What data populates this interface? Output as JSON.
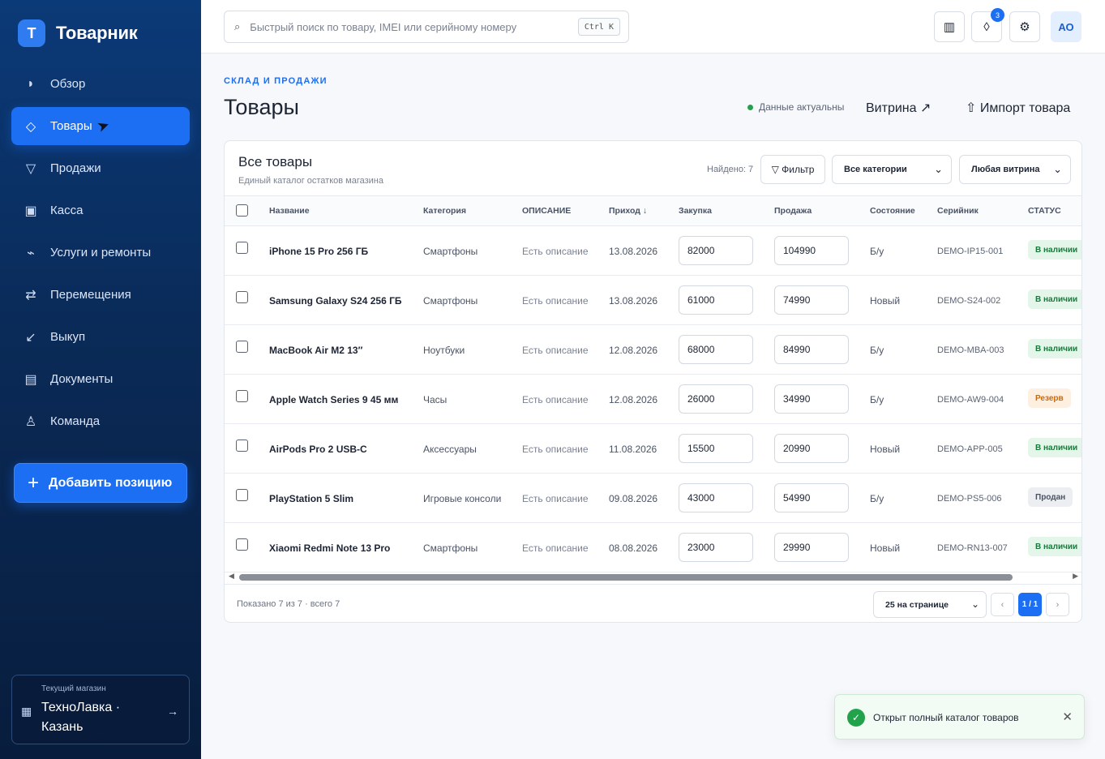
{
  "brand": {
    "logo_letter": "T",
    "name": "Товарник"
  },
  "sidebar": {
    "items": [
      {
        "label": "Обзор",
        "icon": "dot-icon",
        "glyph": "◗"
      },
      {
        "label": "Товары",
        "icon": "diamond-icon",
        "glyph": "◇"
      },
      {
        "label": "Продажи",
        "icon": "funnel-icon",
        "glyph": "▽"
      },
      {
        "label": "Касса",
        "icon": "register-icon",
        "glyph": "▣"
      },
      {
        "label": "Услуги и ремонты",
        "icon": "wrench-icon",
        "glyph": "⌁"
      },
      {
        "label": "Перемещения",
        "icon": "swap-icon",
        "glyph": "⇄"
      },
      {
        "label": "Выкуп",
        "icon": "arrow-down-left-icon",
        "glyph": "↙"
      },
      {
        "label": "Документы",
        "icon": "document-icon",
        "glyph": "▤"
      },
      {
        "label": "Команда",
        "icon": "person-icon",
        "glyph": "♙"
      }
    ],
    "active_index": 1,
    "add_button": {
      "plus": "+",
      "label": "Добавить позицию"
    },
    "store": {
      "caption": "Текущий магазин",
      "name": "ТехноЛавка · Казань",
      "icon": "▦",
      "arrow": "→"
    }
  },
  "topbar": {
    "search_icon": "⌕",
    "search_placeholder": "Быстрый поиск по товару, IMEI или серийному номеру",
    "shortcut": "Ctrl K",
    "columns_icon": "▥",
    "notifications_icon": "◊",
    "notifications_count": "3",
    "settings_icon": "⚙",
    "avatar_initials": "АО"
  },
  "header": {
    "eyebrow": "СКЛАД И ПРОДАЖИ",
    "title": "Товары",
    "status": "Данные актуальны",
    "showcase_link": "Витрина ↗",
    "import_link": "⇧ Импорт товара"
  },
  "card": {
    "title": "Все товары",
    "subtitle": "Единый каталог остатков магазина",
    "found": "Найдено: 7",
    "filter_label": "▽ Фильтр",
    "category_select": "Все категории",
    "showcase_select": "Любая витрина",
    "chevron": "⌄"
  },
  "table": {
    "columns": [
      "Название",
      "Категория",
      "ОПИСАНИЕ",
      "Приход ↓",
      "Закупка",
      "Продажа",
      "Состояние",
      "Серийник",
      "СТАТУС"
    ],
    "rows": [
      {
        "name": "iPhone 15 Pro 256 ГБ",
        "category": "Смартфоны",
        "description": "Есть описание",
        "date": "13.08.2026",
        "purchase": "82000",
        "sale": "104990",
        "condition": "Б/у",
        "serial": "DEMO-IP15-001",
        "status": "В наличии",
        "status_color": "green"
      },
      {
        "name": "Samsung Galaxy S24 256 ГБ",
        "category": "Смартфоны",
        "description": "Есть описание",
        "date": "13.08.2026",
        "purchase": "61000",
        "sale": "74990",
        "condition": "Новый",
        "serial": "DEMO-S24-002",
        "status": "В наличии",
        "status_color": "green"
      },
      {
        "name": "MacBook Air M2 13″",
        "category": "Ноутбуки",
        "description": "Есть описание",
        "date": "12.08.2026",
        "purchase": "68000",
        "sale": "84990",
        "condition": "Б/у",
        "serial": "DEMO-MBA-003",
        "status": "В наличии",
        "status_color": "green"
      },
      {
        "name": "Apple Watch Series 9 45 мм",
        "category": "Часы",
        "description": "Есть описание",
        "date": "12.08.2026",
        "purchase": "26000",
        "sale": "34990",
        "condition": "Б/у",
        "serial": "DEMO-AW9-004",
        "status": "Резерв",
        "status_color": "amber"
      },
      {
        "name": "AirPods Pro 2 USB-C",
        "category": "Аксессуары",
        "description": "Есть описание",
        "date": "11.08.2026",
        "purchase": "15500",
        "sale": "20990",
        "condition": "Новый",
        "serial": "DEMO-APP-005",
        "status": "В наличии",
        "status_color": "green"
      },
      {
        "name": "PlayStation 5 Slim",
        "category": "Игровые консоли",
        "description": "Есть описание",
        "date": "09.08.2026",
        "purchase": "43000",
        "sale": "54990",
        "condition": "Б/у",
        "serial": "DEMO-PS5-006",
        "status": "Продан",
        "status_color": "gray"
      },
      {
        "name": "Xiaomi Redmi Note 13 Pro",
        "category": "Смартфоны",
        "description": "Есть описание",
        "date": "08.08.2026",
        "purchase": "23000",
        "sale": "29990",
        "condition": "Новый",
        "serial": "DEMO-RN13-007",
        "status": "В наличии",
        "status_color": "green"
      }
    ]
  },
  "footer": {
    "shown": "Показано 7 из 7 · всего 7",
    "per_page": "25 на странице",
    "prev": "‹",
    "page": "1 / 1",
    "next": "›"
  },
  "toast": {
    "icon": "✓",
    "message": "Открыт полный каталог товаров",
    "close": "✕"
  }
}
